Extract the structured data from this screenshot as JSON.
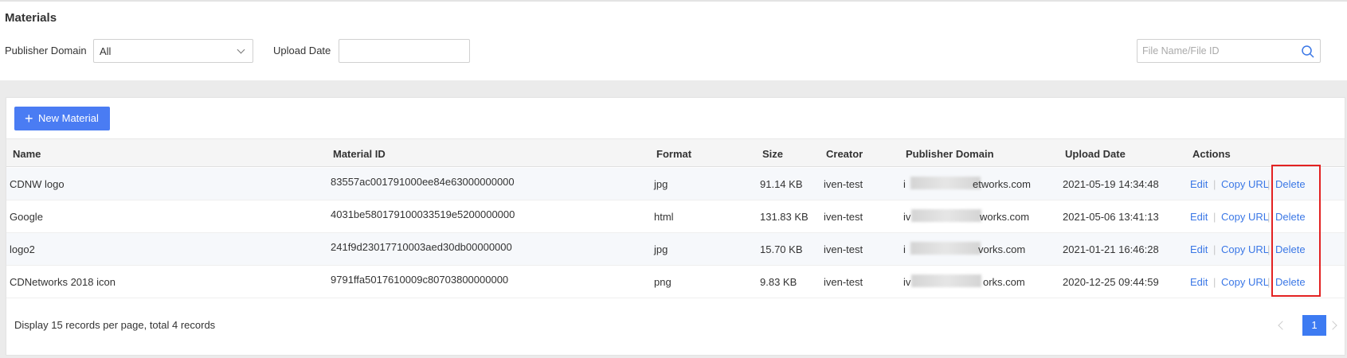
{
  "header": {
    "title": "Materials",
    "publisher_domain_label": "Publisher Domain",
    "publisher_domain_value": "All",
    "upload_date_label": "Upload Date",
    "upload_date_value": "",
    "search_placeholder": "File Name/File ID"
  },
  "toolbar": {
    "new_material_label": "New Material"
  },
  "table": {
    "columns": {
      "name": "Name",
      "material_id": "Material ID",
      "format": "Format",
      "size": "Size",
      "creator": "Creator",
      "publisher_domain": "Publisher Domain",
      "upload_date": "Upload Date",
      "actions": "Actions"
    },
    "action_labels": {
      "edit": "Edit",
      "copy_url": "Copy URL",
      "delete": "Delete",
      "separator": "|"
    },
    "rows": [
      {
        "name": "CDNW logo",
        "material_id": "83557ac001791000ee84e63000000000",
        "format": "jpg",
        "size": "91.14 KB",
        "creator": "iven-test",
        "domain_prefix": "i",
        "domain_suffix": "etworks.com",
        "upload_date": "2021-05-19 14:34:48"
      },
      {
        "name": "Google",
        "material_id": "4031be580179100033519e5200000000",
        "format": "html",
        "size": "131.83 KB",
        "creator": "iven-test",
        "domain_prefix": "iv",
        "domain_suffix": "works.com",
        "upload_date": "2021-05-06 13:41:13"
      },
      {
        "name": "logo2",
        "material_id": "241f9d23017710003aed30db00000000",
        "format": "jpg",
        "size": "15.70 KB",
        "creator": "iven-test",
        "domain_prefix": "i",
        "domain_suffix": "vorks.com",
        "upload_date": "2021-01-21 16:46:28"
      },
      {
        "name": "CDNetworks 2018 icon",
        "material_id": "9791ffa5017610009c80703800000000",
        "format": "png",
        "size": "9.83 KB",
        "creator": "iven-test",
        "domain_prefix": "iv",
        "domain_suffix": "orks.com",
        "upload_date": "2020-12-25 09:44:59"
      }
    ]
  },
  "footer": {
    "records_text": "Display 15 records per page, total 4 records",
    "current_page": "1"
  },
  "colors": {
    "primary": "#4a7cf3",
    "link": "#3a77e6",
    "highlight_border": "#e32222"
  },
  "icons": {
    "search": "search-icon",
    "chevron": "chevron-down-icon",
    "plus": "plus-icon"
  }
}
